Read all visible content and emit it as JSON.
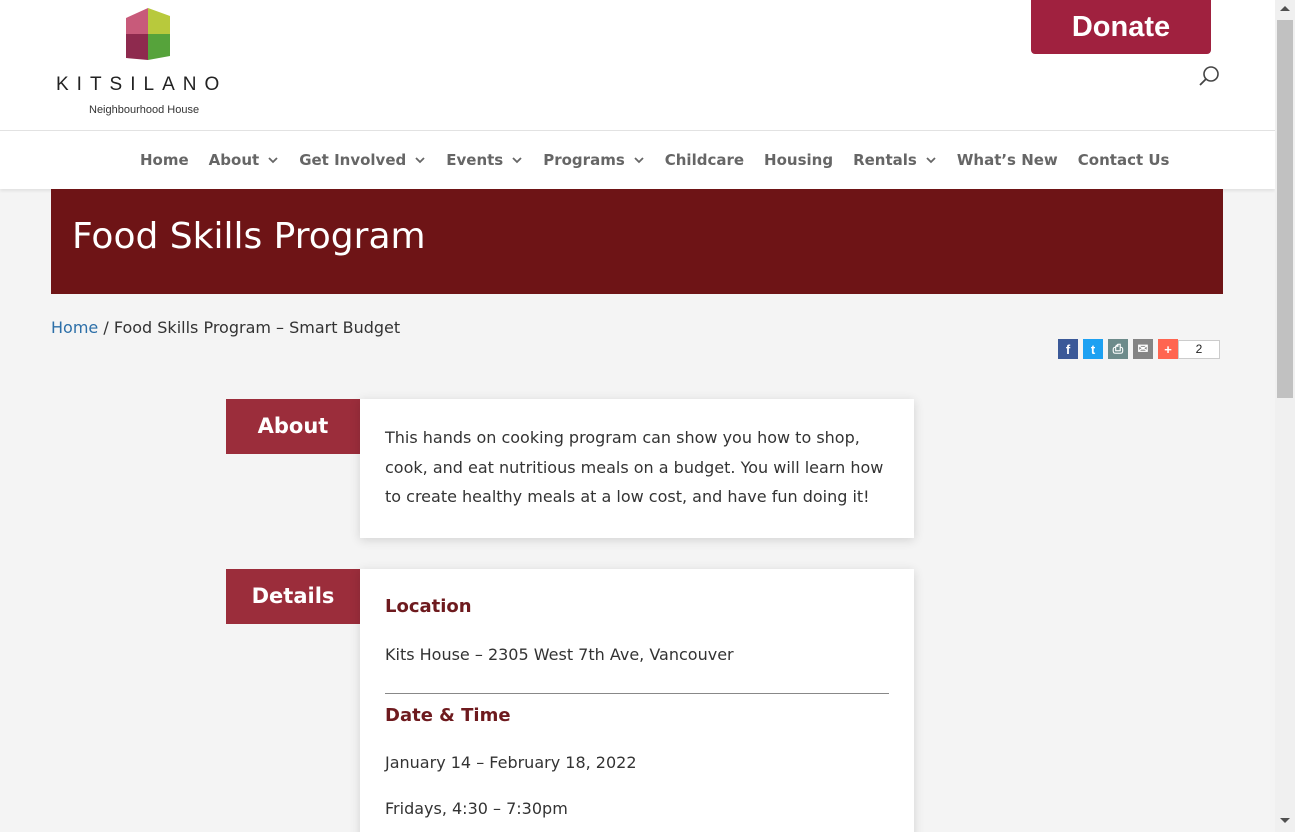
{
  "brand": {
    "name": "KITSILANO",
    "subtitle": "Neighbourhood House",
    "colors": {
      "accent": "#a0213f",
      "hero": "#6e1416",
      "section": "#9b2d3b",
      "heading": "#6e1a1e",
      "link": "#2c6fa8"
    }
  },
  "header": {
    "donate_label": "Donate",
    "search_icon": "search-icon"
  },
  "nav": {
    "items": [
      {
        "label": "Home",
        "dropdown": false
      },
      {
        "label": "About",
        "dropdown": true
      },
      {
        "label": "Get Involved",
        "dropdown": true
      },
      {
        "label": "Events",
        "dropdown": true
      },
      {
        "label": "Programs",
        "dropdown": true
      },
      {
        "label": "Childcare",
        "dropdown": false
      },
      {
        "label": "Housing",
        "dropdown": false
      },
      {
        "label": "Rentals",
        "dropdown": true
      },
      {
        "label": "What’s New",
        "dropdown": false
      },
      {
        "label": "Contact Us",
        "dropdown": false
      }
    ]
  },
  "page": {
    "title": "Food Skills Program",
    "breadcrumb": {
      "home": "Home",
      "separator": " / ",
      "current": "Food Skills Program – Smart Budget"
    }
  },
  "share": {
    "buttons": [
      {
        "name": "facebook-icon",
        "glyph": "f",
        "color": "#3b5998"
      },
      {
        "name": "twitter-icon",
        "glyph": "t",
        "color": "#1da1f2"
      },
      {
        "name": "print-icon",
        "glyph": "⎙",
        "color": "#6d8b8b"
      },
      {
        "name": "email-icon",
        "glyph": "✉",
        "color": "#848484"
      },
      {
        "name": "plus-icon",
        "glyph": "+",
        "color": "#ff6550"
      }
    ],
    "count": "2"
  },
  "about": {
    "label": "About",
    "text": "This hands on cooking program can show you how to shop, cook, and eat nutritious meals on a budget. You will learn how to create healthy meals at a low cost, and have fun doing it!"
  },
  "details": {
    "label": "Details",
    "location_heading": "Location",
    "location": "Kits House – 2305 West 7th Ave, Vancouver",
    "datetime_heading": "Date & Time",
    "dates": "January 14 – February 18, 2022",
    "time": "Fridays, 4:30 – 7:30pm"
  }
}
